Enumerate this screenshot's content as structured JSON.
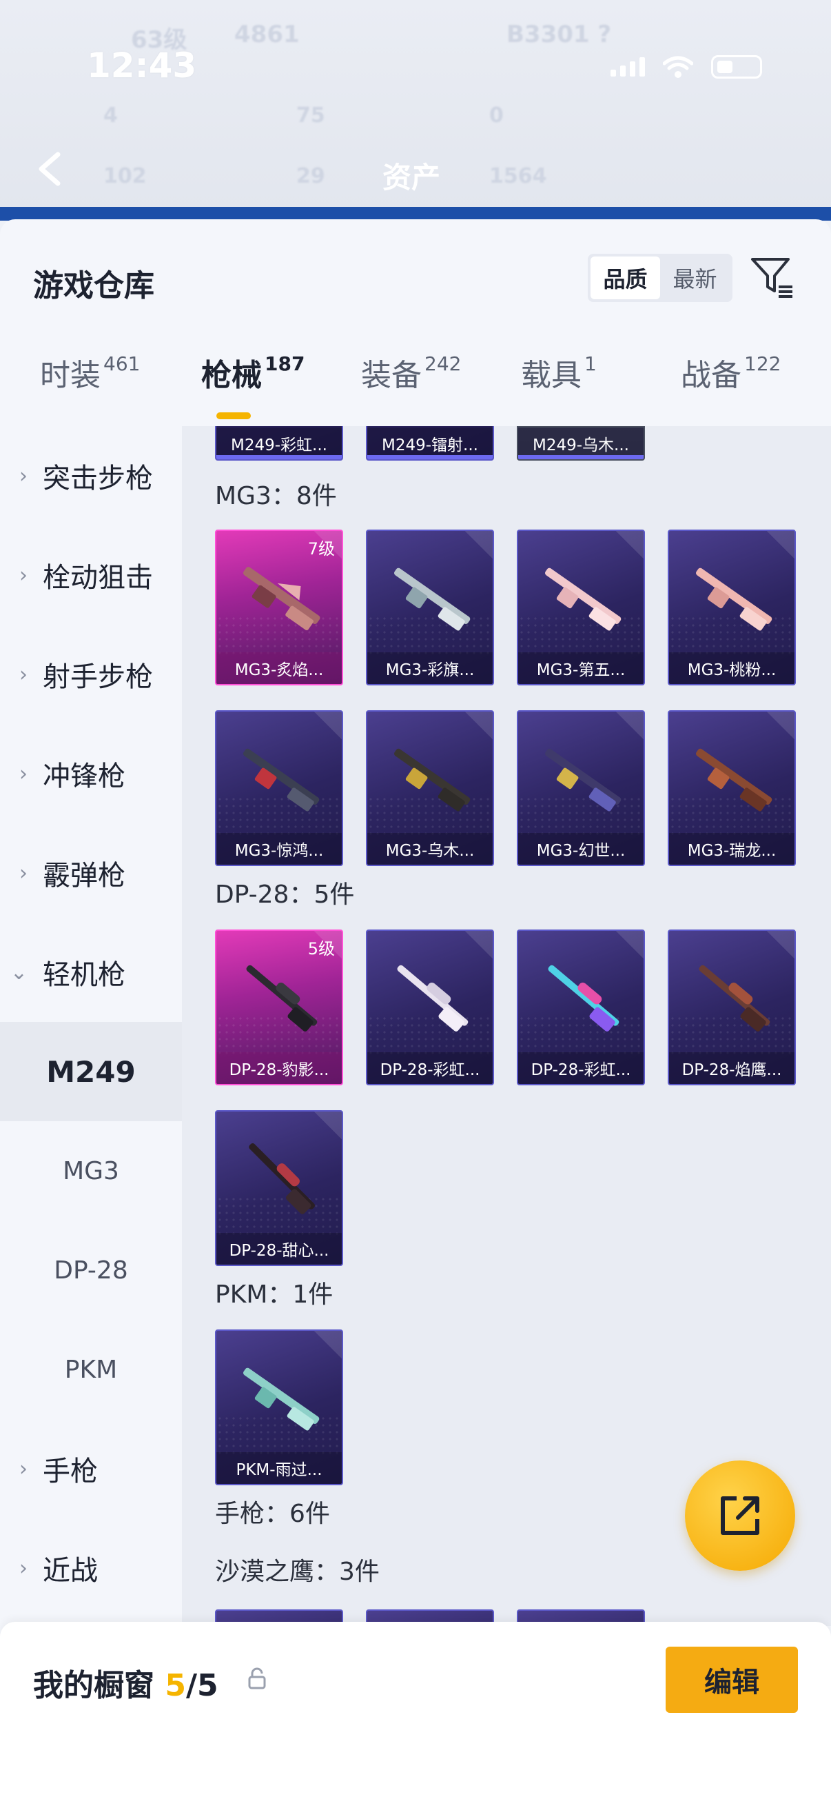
{
  "status": {
    "time": "12:43"
  },
  "background": {
    "level": "63级",
    "score": "4861",
    "id": "B3301 ?",
    "stats": [
      "4",
      "75",
      "0",
      "102",
      "29",
      "1564"
    ],
    "title": "资产"
  },
  "sheet": {
    "title": "游戏仓库",
    "sort_options": [
      "品质",
      "最新"
    ],
    "sort_selected": "品质"
  },
  "tabs": [
    {
      "label": "时装",
      "count": "461"
    },
    {
      "label": "枪械",
      "count": "187"
    },
    {
      "label": "装备",
      "count": "242"
    },
    {
      "label": "载具",
      "count": "1"
    },
    {
      "label": "战备",
      "count": "122"
    }
  ],
  "sidebar": {
    "categories": [
      "突击步枪",
      "栓动狙击",
      "射手步枪",
      "冲锋枪",
      "霰弹枪",
      "轻机枪",
      "手枪",
      "近战"
    ],
    "subitems": [
      "M249",
      "MG3",
      "DP-28",
      "PKM"
    ],
    "active_subitem": "M249"
  },
  "content": {
    "m249_cards": [
      "M249-彩虹...",
      "M249-镭射...",
      "M249-乌木..."
    ],
    "mg3_label": "MG3：8件",
    "mg3_cards": [
      {
        "name": "MG3-炙焰...",
        "level": "7级"
      },
      {
        "name": "MG3-彩旗..."
      },
      {
        "name": "MG3-第五..."
      },
      {
        "name": "MG3-桃粉..."
      },
      {
        "name": "MG3-惊鸿..."
      },
      {
        "name": "MG3-乌木..."
      },
      {
        "name": "MG3-幻世..."
      },
      {
        "name": "MG3-瑞龙..."
      }
    ],
    "dp28_label": "DP-28：5件",
    "dp28_cards": [
      {
        "name": "DP-28-豹影...",
        "level": "5级"
      },
      {
        "name": "DP-28-彩虹..."
      },
      {
        "name": "DP-28-彩虹..."
      },
      {
        "name": "DP-28-焰鹰..."
      },
      {
        "name": "DP-28-甜心..."
      }
    ],
    "pkm_label": "PKM：1件",
    "pkm_cards": [
      {
        "name": "PKM-雨过..."
      }
    ],
    "pistol_label": "手枪：6件",
    "deagle_label": "沙漠之鹰：3件"
  },
  "bottom": {
    "showcase_label": "我的橱窗",
    "count_current": "5",
    "count_sep": "/",
    "count_total": "5",
    "edit_label": "编辑"
  },
  "colors": {
    "accent": "#f5b400",
    "edit_button": "#f5ab12",
    "card_pink": "#e23ab8",
    "card_purple": "#4b3f8f"
  }
}
